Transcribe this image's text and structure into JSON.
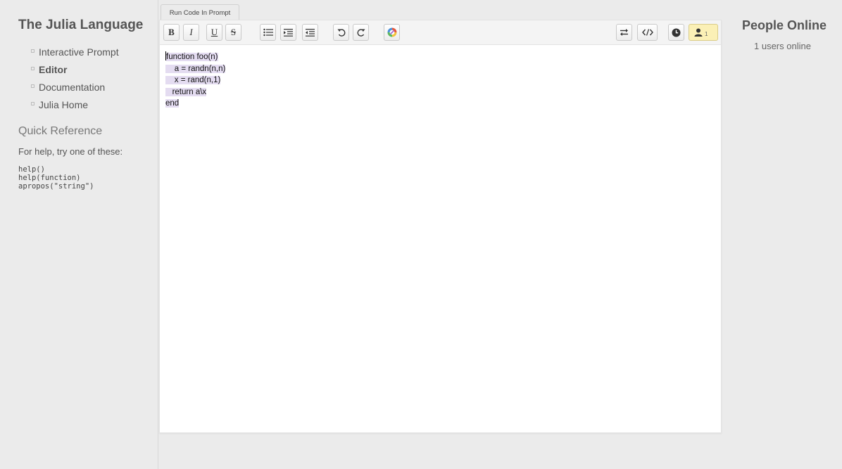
{
  "sidebar": {
    "title": "The Julia Language",
    "nav": [
      {
        "label": "Interactive Prompt",
        "active": false
      },
      {
        "label": "Editor",
        "active": true
      },
      {
        "label": "Documentation",
        "active": false
      },
      {
        "label": "Julia Home",
        "active": false
      }
    ],
    "quick_reference": {
      "title": "Quick Reference",
      "help_text": "For help, try one of these:",
      "commands": [
        "help()",
        "help(function)",
        "apropos(\"string\")"
      ]
    }
  },
  "editor": {
    "tab_label": "Run Code In Prompt",
    "toolbar": {
      "bold_label": "B",
      "italic_label": "I",
      "underline_label": "U",
      "strike_label": "S",
      "users_count": "1"
    },
    "code_lines": [
      "function foo(n)",
      "    a = randn(n,n)",
      "    x = rand(n,1)",
      "   return a\\x",
      "end"
    ]
  },
  "right_panel": {
    "title": "People Online",
    "count_text": "1 users online"
  },
  "colors": {
    "selection": "#e4dcf1",
    "users_button": "#fbf0b6",
    "background": "#ebebeb"
  }
}
